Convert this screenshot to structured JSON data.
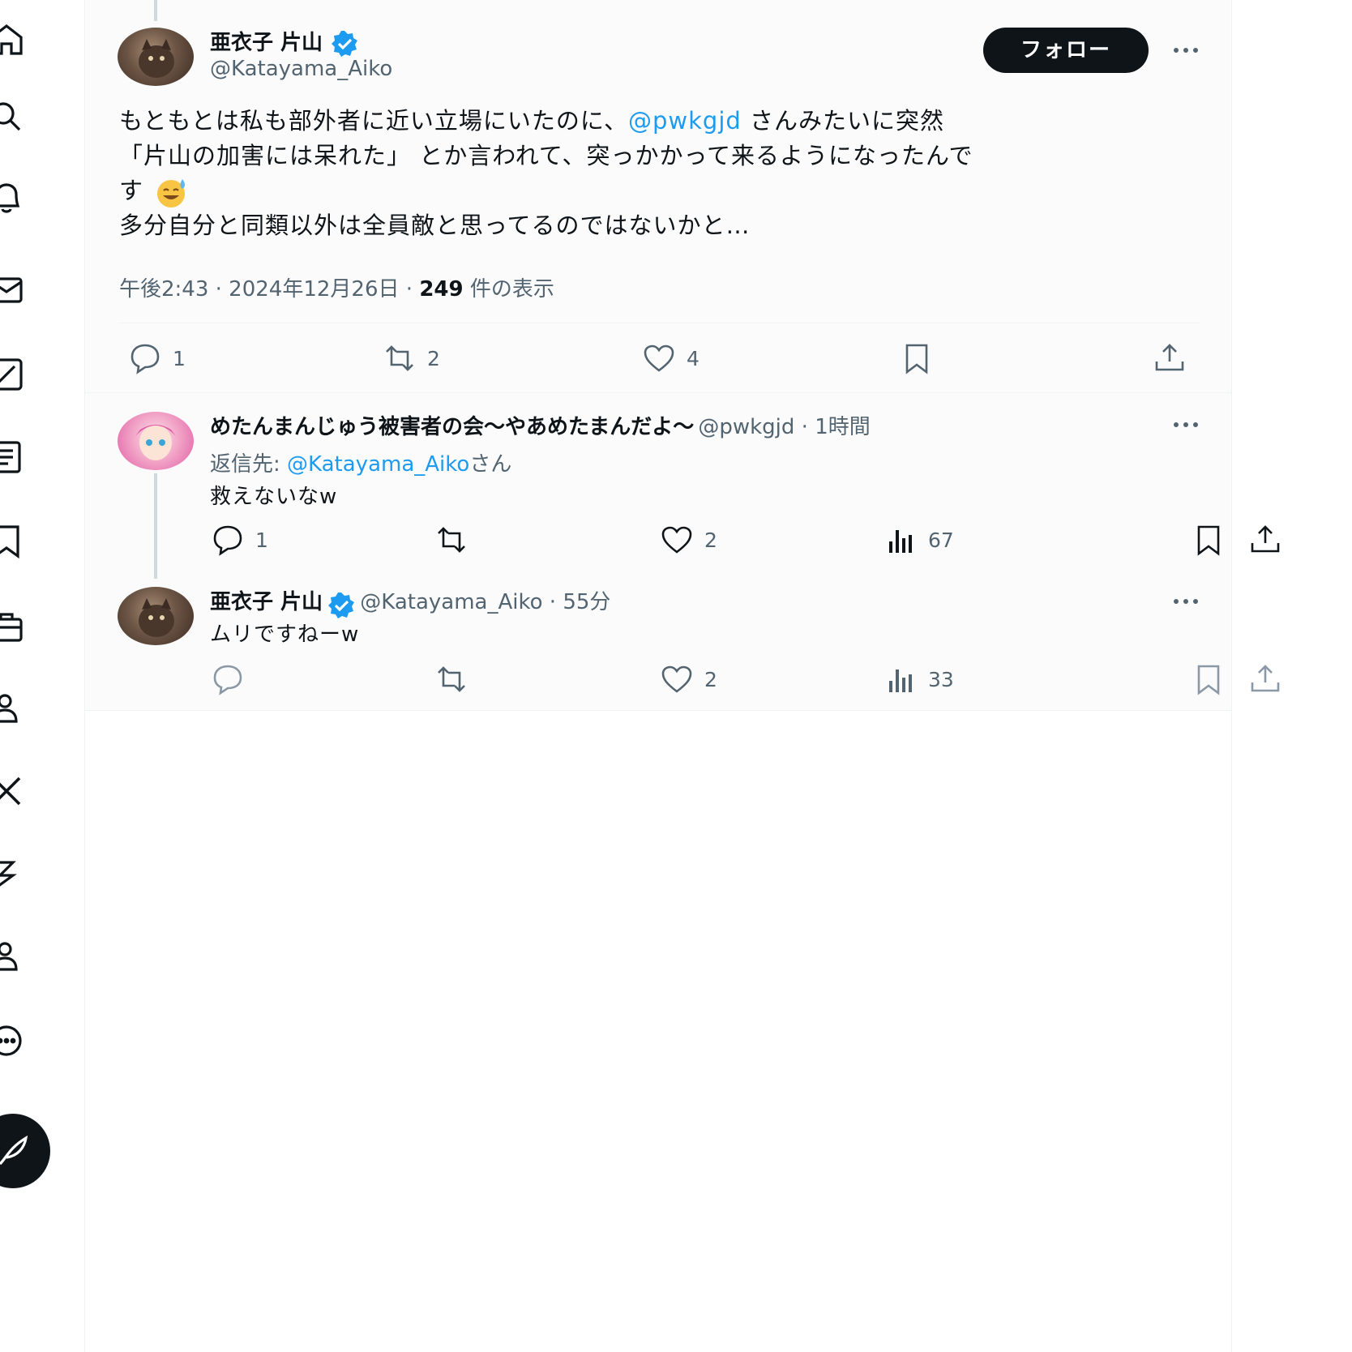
{
  "main_tweet": {
    "author_name": "亜衣子 片山",
    "author_handle": "@Katayama_Aiko",
    "follow_label": "フォロー",
    "text_line1_before": "もともとは私も部外者に近い立場にいたのに、",
    "text_line1_mention": "@pwkgjd",
    "text_line1_after": " さんみたいに突然",
    "text_line2": "「片山の加害には呆れた」 とか言われて、突っかかって来るようになったんで",
    "text_line3": "す",
    "text_line4": "多分自分と同類以外は全員敵と思ってるのではないかと…",
    "time": "午後2:43 · 2024年12月26日 · ",
    "view_count": "249",
    "view_label": " 件の表示",
    "reply_count": "1",
    "retweet_count": "2",
    "like_count": "4"
  },
  "reply1": {
    "author_name": "めたんまんじゅう被害者の会〜やあめたまんだよ〜",
    "author_handle": "@pwkgjd",
    "time_sep": " · ",
    "time": "1時間",
    "replying_to_prefix": "返信先: ",
    "replying_to_handle": "@Katayama_Aiko",
    "replying_to_suffix": "さん",
    "text": "救えないなw",
    "reply_count": "1",
    "like_count": "2",
    "view_count": "67"
  },
  "reply2": {
    "author_name": "亜衣子 片山",
    "author_handle": "@Katayama_Aiko",
    "time_sep": " · ",
    "time": "55分",
    "text": "ムリですねーw",
    "like_count": "2",
    "view_count": "33"
  },
  "colors": {
    "accent": "#1d9bf0",
    "text_primary": "#0f1419",
    "text_secondary": "#536471",
    "divider": "#eff3f4"
  },
  "nav_icons": [
    "home-icon",
    "search-icon",
    "notifications-icon",
    "messages-icon",
    "grok-icon",
    "lists-icon",
    "bookmarks-icon",
    "jobs-icon",
    "communities-icon",
    "premium-icon",
    "verified-orgs-icon",
    "profile-icon",
    "more-icon",
    "compose-icon"
  ]
}
